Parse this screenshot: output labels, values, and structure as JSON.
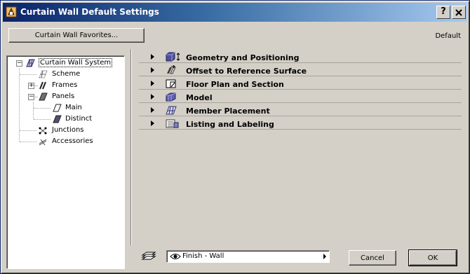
{
  "window": {
    "title": "Curtain Wall Default Settings",
    "help_button": "?",
    "close_button": "X"
  },
  "header": {
    "favorites_button": "Curtain Wall Favorites...",
    "default_label": "Default"
  },
  "tree": {
    "root": "Curtain Wall System",
    "items": [
      {
        "label": "Scheme"
      },
      {
        "label": "Frames"
      },
      {
        "label": "Panels"
      },
      {
        "label": "Main"
      },
      {
        "label": "Distinct"
      },
      {
        "label": "Junctions"
      },
      {
        "label": "Accessories"
      }
    ]
  },
  "sections": [
    {
      "label": "Geometry and Positioning",
      "icon": "geometry-icon"
    },
    {
      "label": "Offset to Reference Surface",
      "icon": "offset-icon"
    },
    {
      "label": "Floor Plan and Section",
      "icon": "floor-plan-icon"
    },
    {
      "label": "Model",
      "icon": "model-icon"
    },
    {
      "label": "Member Placement",
      "icon": "member-placement-icon"
    },
    {
      "label": "Listing and Labeling",
      "icon": "listing-icon"
    }
  ],
  "footer": {
    "finish_value": "Finish - Wall",
    "cancel_button": "Cancel",
    "ok_button": "OK"
  },
  "colors": {
    "title_start": "#0a246a",
    "title_end": "#a6caf0",
    "face": "#d4d0c8"
  }
}
